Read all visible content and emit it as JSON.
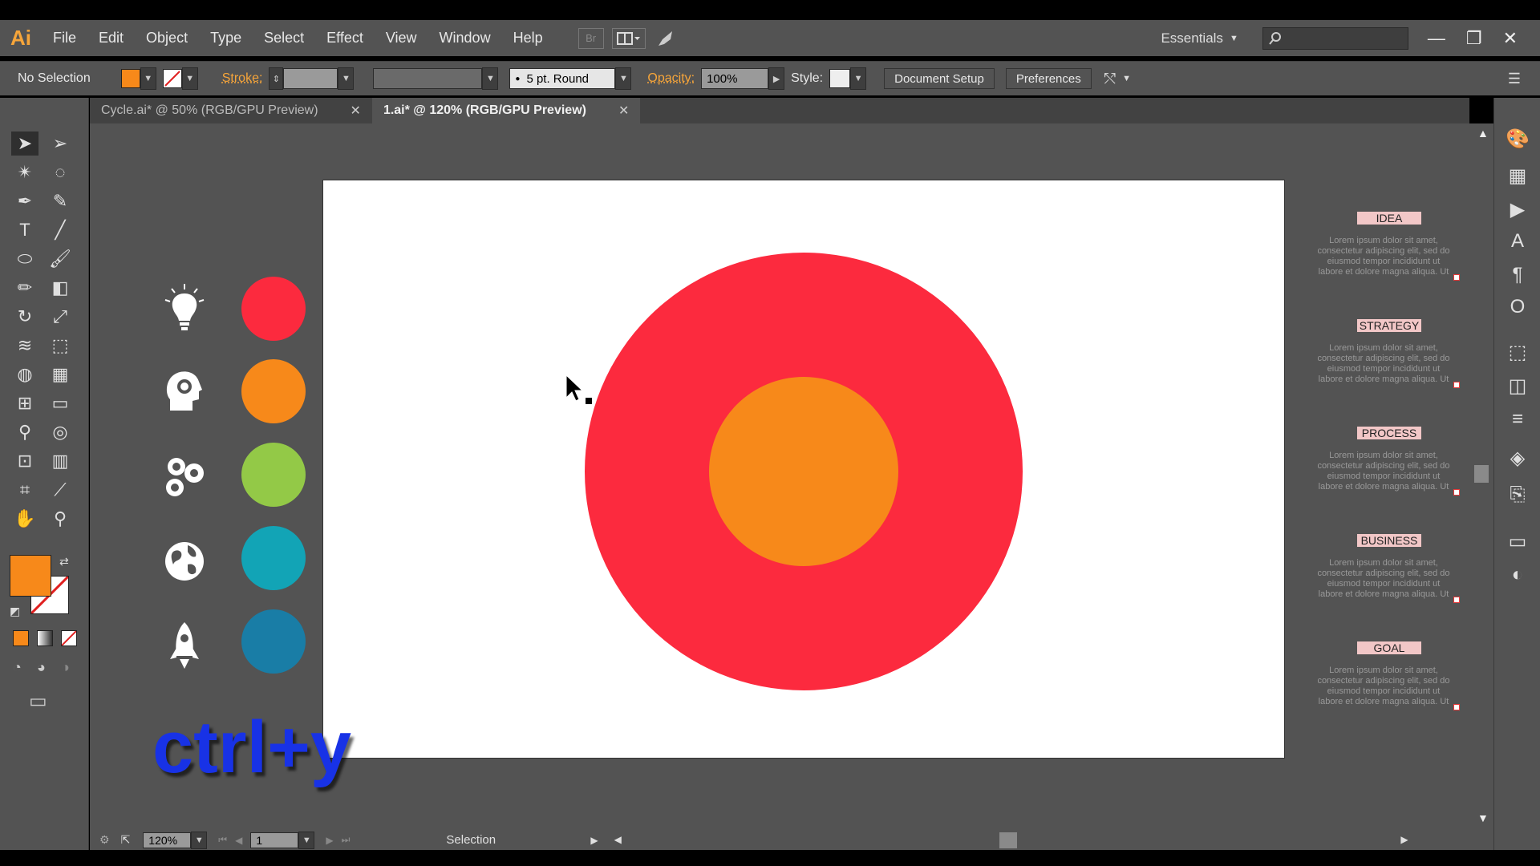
{
  "app": {
    "logo": "Ai",
    "workspace": "Essentials"
  },
  "menu": [
    "File",
    "Edit",
    "Object",
    "Type",
    "Select",
    "Effect",
    "View",
    "Window",
    "Help"
  ],
  "menu_icons": {
    "bridge": "Br"
  },
  "control": {
    "selection": "No Selection",
    "fill_color": "#f7891a",
    "stroke_label": "Stroke:",
    "brush": "5 pt. Round",
    "opacity_label": "Opacity:",
    "opacity": "100%",
    "style_label": "Style:",
    "document_setup": "Document Setup",
    "preferences": "Preferences"
  },
  "tabs": [
    {
      "label": "Cycle.ai* @ 50% (RGB/GPU Preview)",
      "active": false
    },
    {
      "label": "1.ai* @ 120% (RGB/GPU Preview)",
      "active": true
    }
  ],
  "artboard": {
    "outer_circle_color": "#fc2a3e",
    "inner_circle_color": "#f7891a"
  },
  "icon_colors": [
    "#fc2a3e",
    "#f7891a",
    "#93c947",
    "#12a4b6",
    "#197da6"
  ],
  "timeline": [
    {
      "title": "IDEA",
      "body": "Lorem ipsum dolor sit amet, consectetur adipiscing elit, sed do eiusmod tempor incididunt ut labore et dolore magna aliqua. Ut"
    },
    {
      "title": "STRATEGY",
      "body": "Lorem ipsum dolor sit amet, consectetur adipiscing elit, sed do eiusmod tempor incididunt ut labore et dolore magna aliqua. Ut"
    },
    {
      "title": "PROCESS",
      "body": "Lorem ipsum dolor sit amet, consectetur adipiscing elit, sed do eiusmod tempor incididunt ut labore et dolore magna aliqua. Ut"
    },
    {
      "title": "BUSINESS",
      "body": "Lorem ipsum dolor sit amet, consectetur adipiscing elit, sed do eiusmod tempor incididunt ut labore et dolore magna aliqua. Ut"
    },
    {
      "title": "GOAL",
      "body": "Lorem ipsum dolor sit amet, consectetur adipiscing elit, sed do eiusmod tempor incididunt ut labore et dolore magna aliqua. Ut"
    }
  ],
  "overlay_text": "ctrl+y",
  "status": {
    "zoom": "120%",
    "page": "1",
    "tool": "Selection"
  }
}
